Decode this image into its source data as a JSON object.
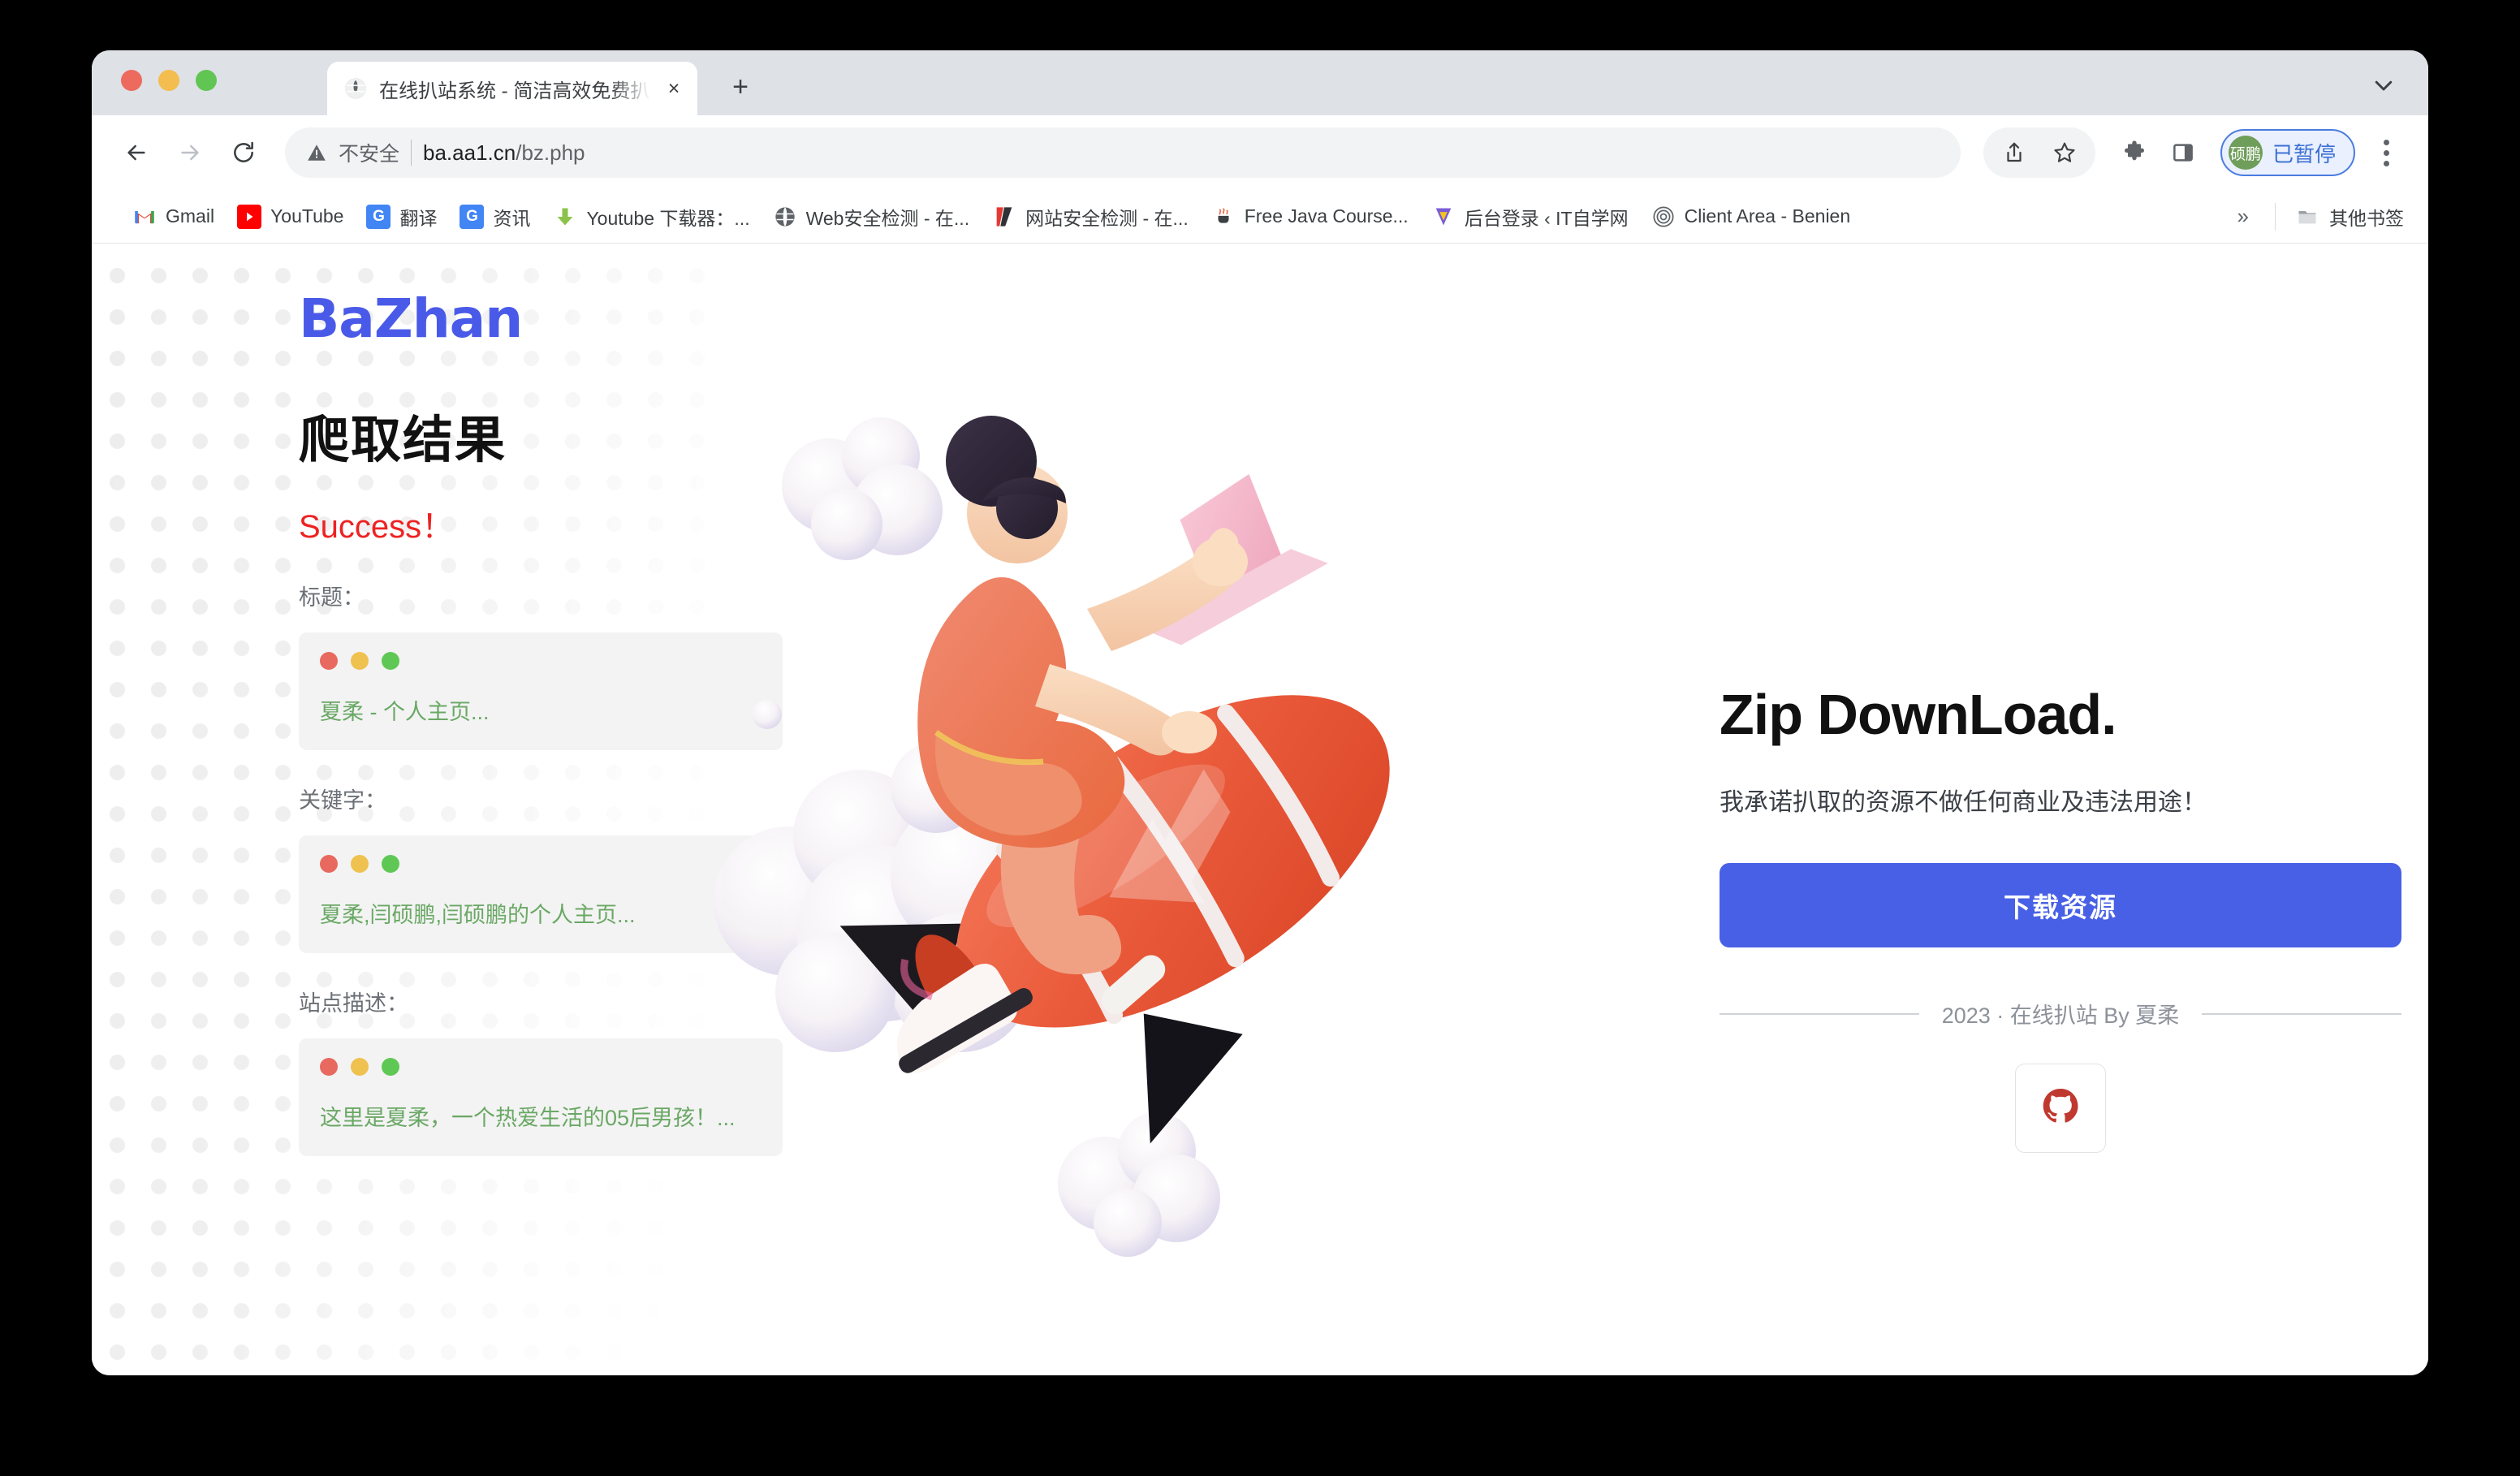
{
  "browser": {
    "tab": {
      "title": "在线扒站系统 - 简洁高效免费扒站",
      "favicon": "globe-icon",
      "close_label": "×"
    },
    "new_tab_label": "+",
    "toolbar": {
      "back_icon": "arrow-left-icon",
      "forward_icon": "arrow-right-icon",
      "reload_icon": "reload-icon",
      "security_label": "不安全",
      "warning_icon": "warning-triangle-icon",
      "url_host": "ba.aa1.cn",
      "url_path": "/bz.php",
      "share_icon": "share-icon",
      "bookmark_icon": "star-icon",
      "extensions_icon": "puzzle-piece-icon",
      "sidepanel_icon": "side-panel-icon",
      "profile_initials": "硕鹏",
      "profile_status": "已暂停",
      "menu_icon": "three-dot-menu-icon"
    },
    "bookmarks": [
      {
        "label": "Gmail",
        "icon": "gmail-icon",
        "glyph": "M",
        "color": "#ea4335",
        "bg": "#ffffff"
      },
      {
        "label": "YouTube",
        "icon": "youtube-icon",
        "glyph": "▶",
        "color": "#ffffff",
        "bg": "#ff0000"
      },
      {
        "label": "翻译",
        "icon": "google-translate-icon",
        "glyph": "G",
        "color": "#ffffff",
        "bg": "#4285f4"
      },
      {
        "label": "资讯",
        "icon": "google-news-icon",
        "glyph": "G",
        "color": "#ffffff",
        "bg": "#4285f4"
      },
      {
        "label": "Youtube 下载器：...",
        "icon": "download-arrow-icon",
        "glyph": "⬇",
        "color": "#8bc34a",
        "bg": "#ffffff"
      },
      {
        "label": "Web安全检测 - 在...",
        "icon": "globe-gray-icon",
        "glyph": "◎",
        "color": "#5f6368",
        "bg": "#ffffff"
      },
      {
        "label": "网站安全检测 - 在...",
        "icon": "red-black-flag-icon",
        "glyph": "◥",
        "color": "#d32f2f",
        "bg": "#ffffff"
      },
      {
        "label": "Free Java Course...",
        "icon": "java-coffee-icon",
        "glyph": "☕",
        "color": "#5f6368",
        "bg": "#ffffff"
      },
      {
        "label": "后台登录 ‹ IT自学网",
        "icon": "purple-v-icon",
        "glyph": "V",
        "color": "#ffffff",
        "bg": "#7b5cd6"
      },
      {
        "label": "Client Area - Benien",
        "icon": "spiral-icon",
        "glyph": "◎",
        "color": "#5f6368",
        "bg": "#ffffff"
      }
    ],
    "bookmarks_overflow_label": "»",
    "other_bookmarks_label": "其他书签",
    "other_bookmarks_icon": "folder-icon",
    "tabstrip_chevron_icon": "chevron-down-icon"
  },
  "page": {
    "brand": "BaZhan",
    "heading": "爬取结果",
    "status": "Success！",
    "fields": [
      {
        "label": "标题：",
        "value": "夏柔 - 个人主页..."
      },
      {
        "label": "关键字：",
        "value": "夏柔,闫硕鹏,闫硕鹏的个人主页..."
      },
      {
        "label": "站点描述：",
        "value": "这里是夏柔，一个热爱生活的05后男孩！..."
      }
    ],
    "illustration_name": "person-riding-rocket-illustration",
    "right": {
      "title": "Zip DownLoad.",
      "subtitle": "我承诺扒取的资源不做任何商业及违法用途！",
      "download_label": "下载资源",
      "footer": "2023 · 在线扒站 By 夏柔",
      "github_icon": "github-icon"
    }
  },
  "colors": {
    "brand_blue": "#4a5ae8",
    "button_blue": "#4860e6",
    "success_red": "#ee2222",
    "value_green": "#6aa865",
    "github_red": "#c0392f"
  }
}
